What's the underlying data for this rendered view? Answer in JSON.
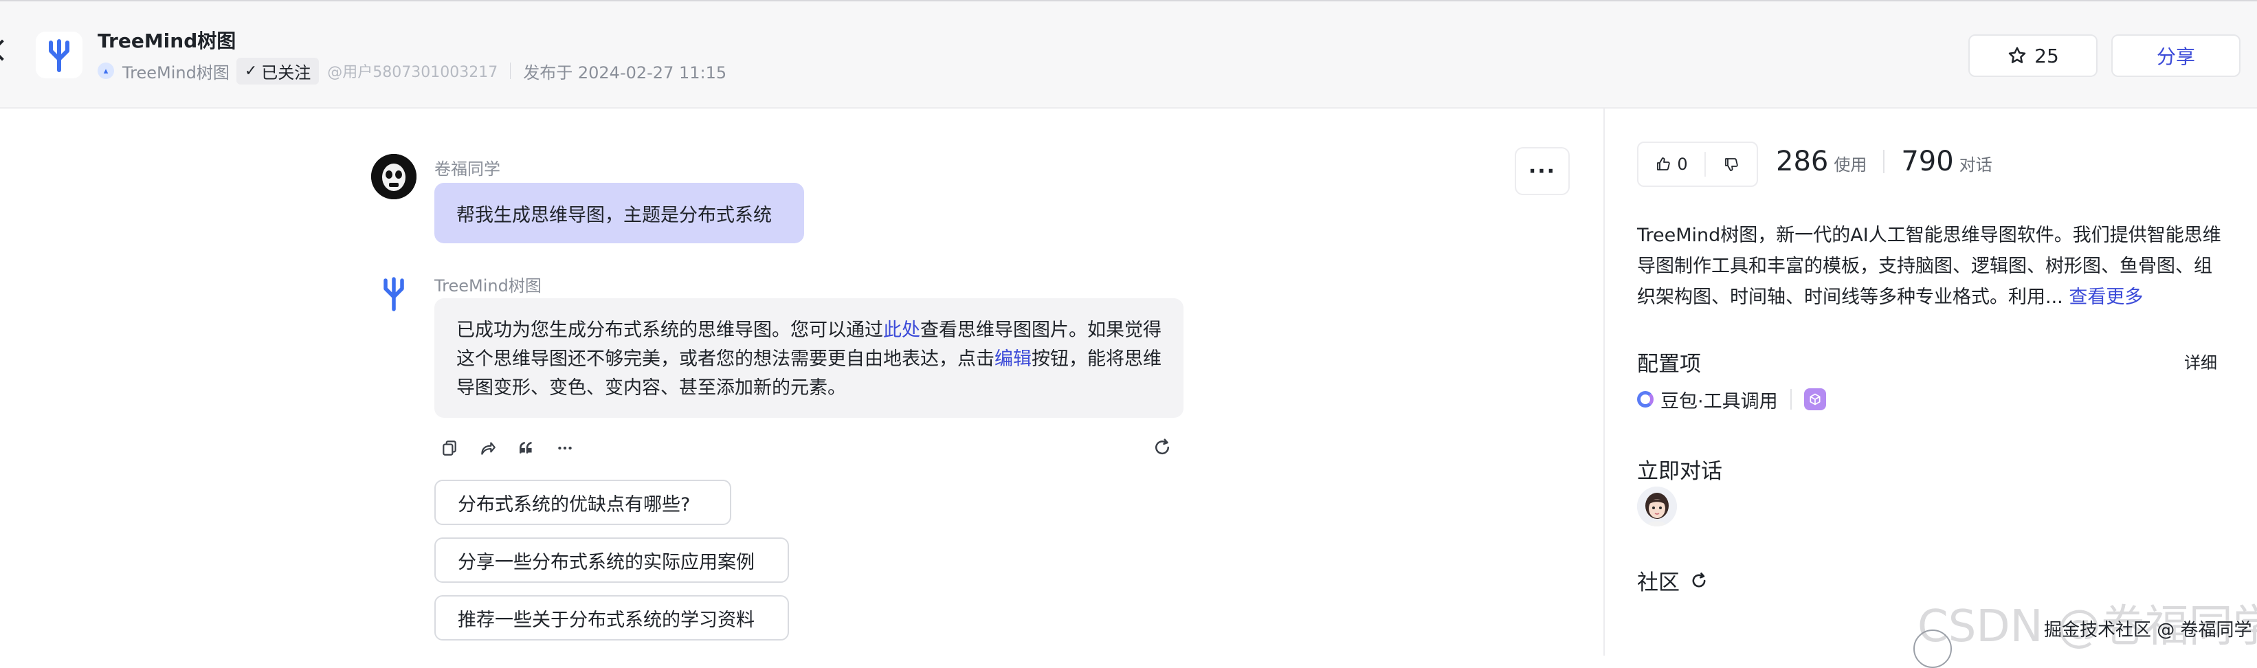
{
  "header": {
    "title": "TreeMind树图",
    "author": "TreeMind树图",
    "follow_label": "已关注",
    "user_handle": "@用户5807301003217",
    "published": "发布于 2024-02-27 11:15",
    "star_count": "25",
    "share_label": "分享"
  },
  "chat": {
    "user_name": "卷福同学",
    "user_message": "帮我生成思维导图，主题是分布式系统",
    "bot_name": "TreeMind树图",
    "bot_message": {
      "part1": "已成功为您生成分布式系统的思维导图。您可以通过",
      "link1": "此处",
      "part2": "查看思维导图图片。如果觉得这个思维导图还不够完美，或者您的想法需要更自由地表达，点击",
      "link2": "编辑",
      "part3": "按钮，能将思维导图变形、变色、变内容、甚至添加新的元素。"
    },
    "suggestions": [
      "分布式系统的优缺点有哪些?",
      "分享一些分布式系统的实际应用案例",
      "推荐一些关于分布式系统的学习资料"
    ]
  },
  "sidebar": {
    "likes": "0",
    "usage_count": "286",
    "usage_label": "使用",
    "dialog_count": "790",
    "dialog_label": "对话",
    "description": "TreeMind树图，新一代的AI人工智能思维导图软件。我们提供智能思维导图制作工具和丰富的模板，支持脑图、逻辑图、树形图、鱼骨图、组织架构图、时间轴、时间线等多种专业格式。利用...",
    "see_more": "查看更多",
    "config_title": "配置项",
    "config_detail": "详细",
    "config_item": "豆包·工具调用",
    "chat_now_title": "立即对话",
    "community_title": "社区"
  },
  "watermark": {
    "csdn": "CSDN @卷福同学",
    "juejin": "掘金技术社区 @ 卷福同学"
  },
  "colors": {
    "accent": "#3b4ad8",
    "user_bubble": "#d3d5fb",
    "bot_bubble": "#f3f3f5",
    "topbar_bg": "#f7f7f8"
  }
}
